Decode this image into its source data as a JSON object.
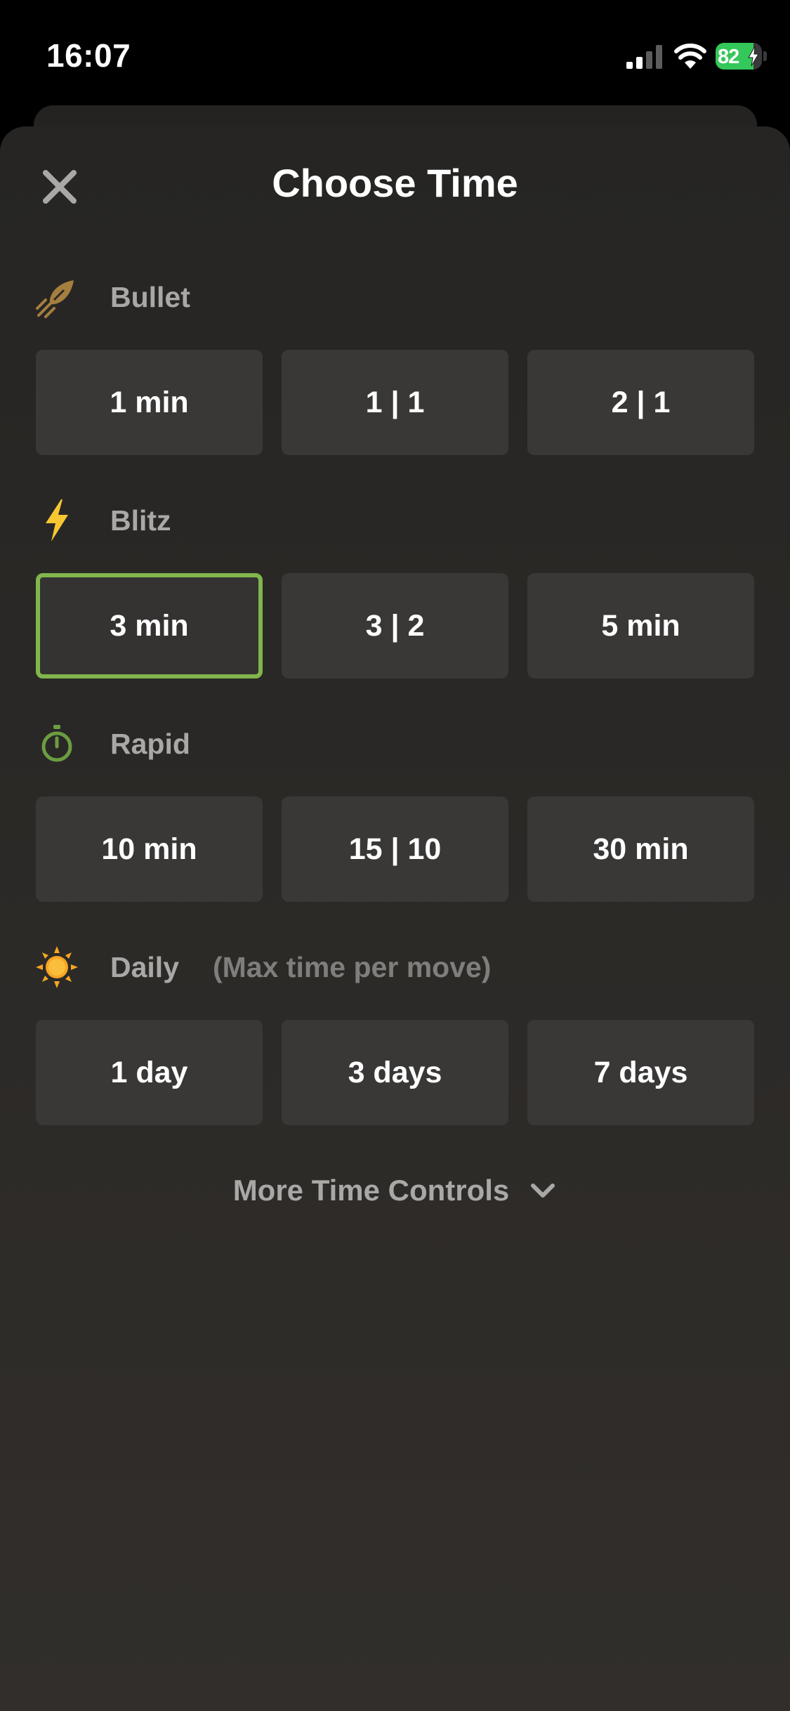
{
  "status_bar": {
    "time": "16:07",
    "battery_percent": "82",
    "battery_level": 0.82
  },
  "sheet": {
    "title": "Choose Time",
    "close_icon": "close-icon"
  },
  "sections": [
    {
      "label": "Bullet",
      "icon": "bullet-rocket-icon",
      "icon_color": "#a57f3f",
      "note": "",
      "options": [
        "1 min",
        "1 | 1",
        "2 | 1"
      ]
    },
    {
      "label": "Blitz",
      "icon": "lightning-bolt-icon",
      "icon_color": "#f7c631",
      "note": "",
      "options": [
        "3 min",
        "3 | 2",
        "5 min"
      ]
    },
    {
      "label": "Rapid",
      "icon": "stopwatch-icon",
      "icon_color": "#6c9d41",
      "note": "",
      "options": [
        "10 min",
        "15 | 10",
        "30 min"
      ]
    },
    {
      "label": "Daily",
      "icon": "sun-icon",
      "icon_color": "#f6a623",
      "note": "(Max time per move)",
      "options": [
        "1 day",
        "3 days",
        "7 days"
      ]
    }
  ],
  "selected_option": "3 min",
  "selection_color": "#81b64c",
  "more_controls": {
    "label": "More Time Controls",
    "icon": "chevron-down-icon"
  }
}
